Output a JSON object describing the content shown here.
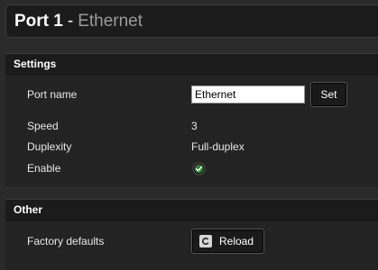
{
  "header": {
    "title": "Port 1",
    "separator": "-",
    "subtitle": "Ethernet"
  },
  "settings": {
    "heading": "Settings",
    "port_name_label": "Port name",
    "port_name_value": "Ethernet",
    "set_button": "Set",
    "speed_label": "Speed",
    "speed_value": "3",
    "duplexity_label": "Duplexity",
    "duplexity_value": "Full-duplex",
    "enable_label": "Enable",
    "enable_state": "enabled",
    "enable_icon": "check-circle-icon",
    "enable_color": "#3a9a3a"
  },
  "other": {
    "heading": "Other",
    "factory_defaults_label": "Factory defaults",
    "reload_button": "Reload",
    "reload_icon": "reload-icon"
  }
}
